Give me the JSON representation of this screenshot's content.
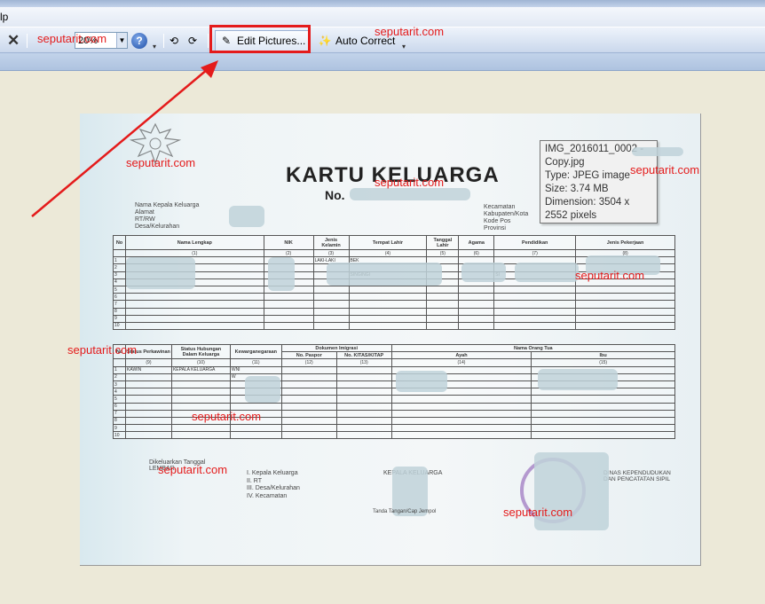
{
  "menubar": {
    "help_label": "lp"
  },
  "toolbar": {
    "zoom_value": "20%",
    "help_label": "?",
    "edit_pictures_label": "Edit Pictures...",
    "auto_correct_label": "Auto Correct"
  },
  "watermark": "seputarit.com",
  "document": {
    "title": "KARTU KELUARGA",
    "number_label": "No.",
    "left_labels": [
      "Nama Kepala Keluarga",
      "Alamat",
      "RT/RW",
      "Desa/Kelurahan"
    ],
    "right_labels": [
      "Kecamatan",
      "Kabupaten/Kota",
      "Kode Pos",
      "Provinsi"
    ],
    "table1": {
      "headers": [
        "No",
        "Nama Lengkap",
        "NIK",
        "Jenis Kelamin",
        "Tempat Lahir",
        "Tanggal Lahir",
        "Agama",
        "Pendidikan",
        "Jenis Pekerjaan"
      ],
      "codes": [
        "",
        "(1)",
        "(2)",
        "(3)",
        "(4)",
        "(5)",
        "(6)",
        "(7)",
        "(8)"
      ],
      "rows": [
        [
          "1",
          "",
          "",
          "LAKI-LAKI",
          "BEK",
          "",
          "",
          "",
          ""
        ],
        [
          "2",
          "",
          "",
          "",
          "",
          "",
          "",
          "",
          ""
        ],
        [
          "3",
          "",
          "",
          "",
          "SINGINGI",
          "",
          "",
          "SI",
          ""
        ],
        [
          "4",
          "",
          "",
          "",
          "",
          "",
          "",
          "",
          ""
        ],
        [
          "5",
          "",
          "",
          "",
          "",
          "",
          "",
          "",
          ""
        ],
        [
          "6",
          "",
          "",
          "",
          "",
          "",
          "",
          "",
          ""
        ],
        [
          "7",
          "",
          "",
          "",
          "",
          "",
          "",
          "",
          ""
        ],
        [
          "8",
          "",
          "",
          "",
          "",
          "",
          "",
          "",
          ""
        ],
        [
          "9",
          "",
          "",
          "",
          "",
          "",
          "",
          "",
          ""
        ],
        [
          "10",
          "",
          "",
          "",
          "",
          "",
          "",
          "",
          ""
        ]
      ]
    },
    "table2": {
      "headers": [
        "No",
        "Status Perkawinan",
        "Status Hubungan Dalam Keluarga",
        "Kewarganegaraan",
        "Dokumen Imigrasi",
        "Nama Orang Tua"
      ],
      "subheaders": [
        "No. Paspor",
        "No. KITAS/KITAP",
        "Ayah",
        "Ibu"
      ],
      "codes": [
        "",
        "(9)",
        "(10)",
        "(11)",
        "(12)",
        "(13)",
        "(14)",
        "(15)"
      ],
      "rows": [
        [
          "1",
          "KAWIN",
          "KEPALA KELUARGA",
          "WNI",
          "",
          "",
          "",
          ""
        ],
        [
          "2",
          "",
          "",
          "W",
          "",
          "",
          "",
          ""
        ],
        [
          "3",
          "",
          "",
          "",
          "",
          "",
          "",
          ""
        ],
        [
          "4",
          "",
          "",
          "",
          "",
          "",
          "",
          ""
        ],
        [
          "5",
          "",
          "",
          "",
          "",
          "",
          "",
          ""
        ],
        [
          "6",
          "",
          "",
          "",
          "",
          "",
          "",
          ""
        ],
        [
          "7",
          "",
          "",
          "",
          "",
          "",
          "",
          ""
        ],
        [
          "8",
          "",
          "",
          "",
          "",
          "",
          "",
          ""
        ],
        [
          "9",
          "",
          "",
          "",
          "",
          "",
          "",
          ""
        ],
        [
          "10",
          "",
          "",
          "",
          "",
          "",
          "",
          ""
        ]
      ]
    },
    "issued_label": "Dikeluarkan Tanggal",
    "sheet_label": "LEMBAR",
    "sheet_list": [
      "I.  Kepala Keluarga",
      "II.  RT",
      "III. Desa/Kelurahan",
      "IV. Kecamatan"
    ],
    "kk_sign": "KEPALA KELUARGA",
    "thumb_label": "Tanda Tangan/Cap Jempol",
    "office_label": "DINAS KEPENDUDUKAN DAN PENCATATAN SIPIL"
  },
  "tooltip": {
    "line1": "IMG_2016011_0002 - Copy.jpg",
    "line2": "Type: JPEG image",
    "line3": "Size: 3.74 MB",
    "line4": "Dimension: 3504 x 2552 pixels"
  }
}
